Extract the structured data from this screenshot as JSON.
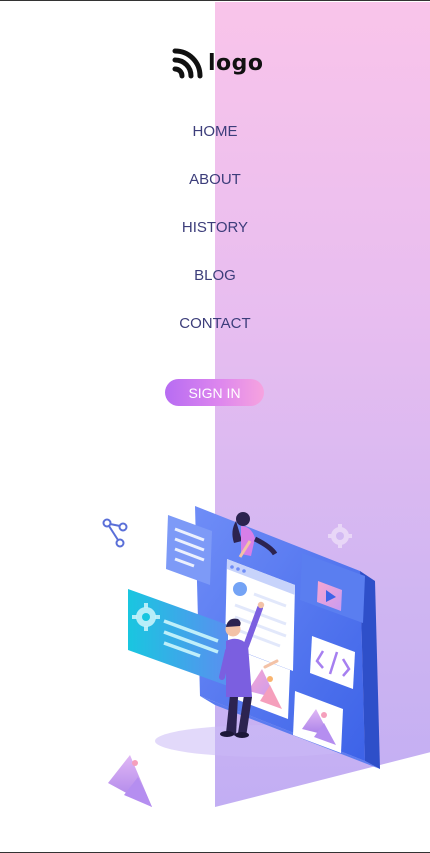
{
  "brand": {
    "logo_text": "logo"
  },
  "nav": {
    "items": [
      {
        "label": "HOME"
      },
      {
        "label": "ABOUT"
      },
      {
        "label": "HISTORY"
      },
      {
        "label": "BLOG"
      },
      {
        "label": "CONTACT"
      }
    ]
  },
  "auth": {
    "signin_label": "SIGN IN"
  },
  "colors": {
    "nav_text": "#3c3d7a",
    "panel_gradient_top": "#f9c4ea",
    "panel_gradient_bottom": "#c2aef3",
    "button_gradient_start": "#b76cf2",
    "button_gradient_end": "#f6a3df"
  },
  "icons": [
    "rss-logo-icon",
    "share-icon",
    "gear-icon",
    "mountain-icon",
    "code-icon",
    "play-icon"
  ]
}
